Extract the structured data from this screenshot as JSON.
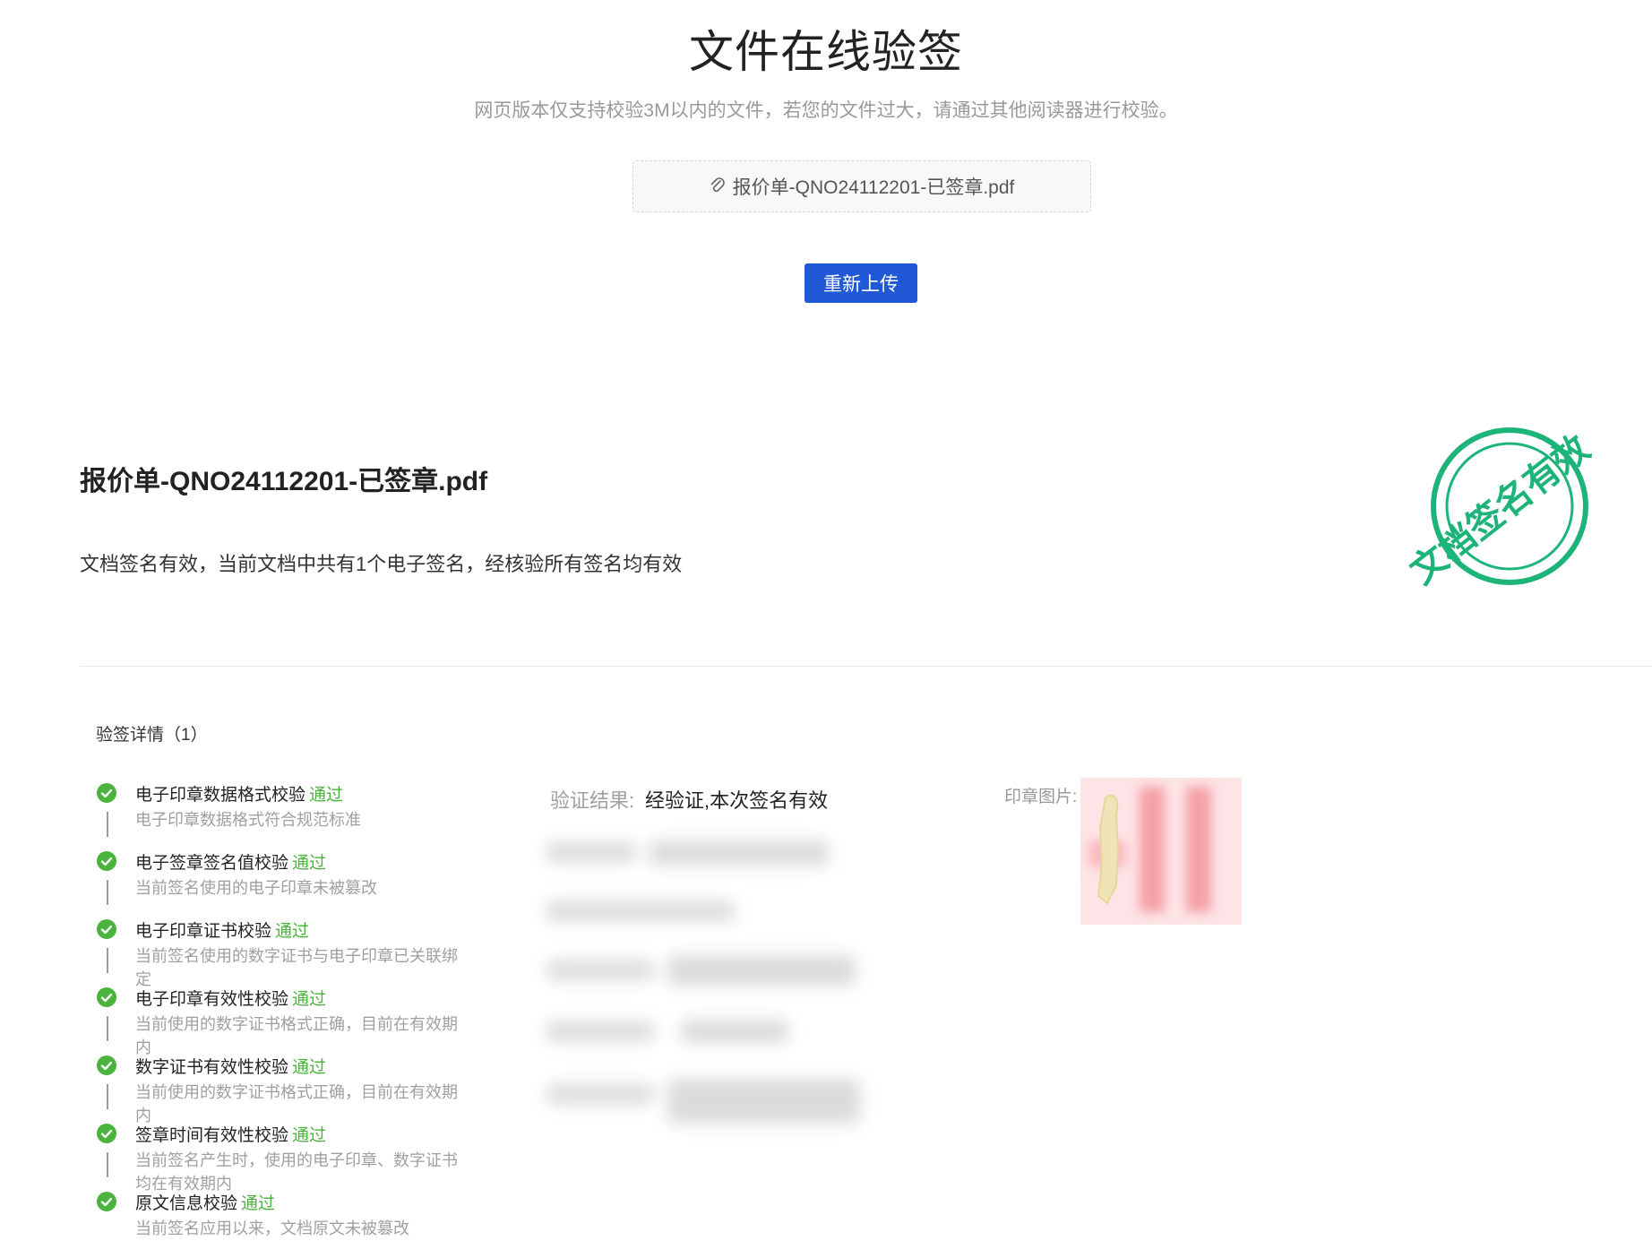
{
  "header": {
    "title": "文件在线验签",
    "subtitle": "网页版本仅支持校验3M以内的文件，若您的文件过大，请通过其他阅读器进行校验。",
    "file_name": "报价单-QNO24112201-已签章.pdf",
    "reupload_label": "重新上传"
  },
  "document": {
    "name": "报价单-QNO24112201-已签章.pdf",
    "status_text": "文档签名有效，当前文档中共有1个电子签名，经核验所有签名均有效",
    "stamp_text": "文档签名有效"
  },
  "details": {
    "title": "验签详情（1）",
    "pass_label": "通过",
    "steps": [
      {
        "name": "电子印章数据格式校验",
        "desc": "电子印章数据格式符合规范标准"
      },
      {
        "name": "电子签章签名值校验",
        "desc": "当前签名使用的电子印章未被篡改"
      },
      {
        "name": "电子印章证书校验",
        "desc": "当前签名使用的数字证书与电子印章已关联绑定"
      },
      {
        "name": "电子印章有效性校验",
        "desc": "当前使用的数字证书格式正确，目前在有效期内"
      },
      {
        "name": "数字证书有效性校验",
        "desc": "当前使用的数字证书格式正确，目前在有效期内"
      },
      {
        "name": "签章时间有效性校验",
        "desc": "当前签名产生时，使用的电子印章、数字证书均在有效期内"
      },
      {
        "name": "原文信息校验",
        "desc": "当前签名应用以来，文档原文未被篡改"
      }
    ],
    "result_label": "验证结果:",
    "result_value": "经验证,本次签名有效",
    "seal_label": "印章图片:"
  },
  "colors": {
    "primary": "#2158d6",
    "pass_green": "#49b33b",
    "stamp_green": "#1db47a"
  }
}
